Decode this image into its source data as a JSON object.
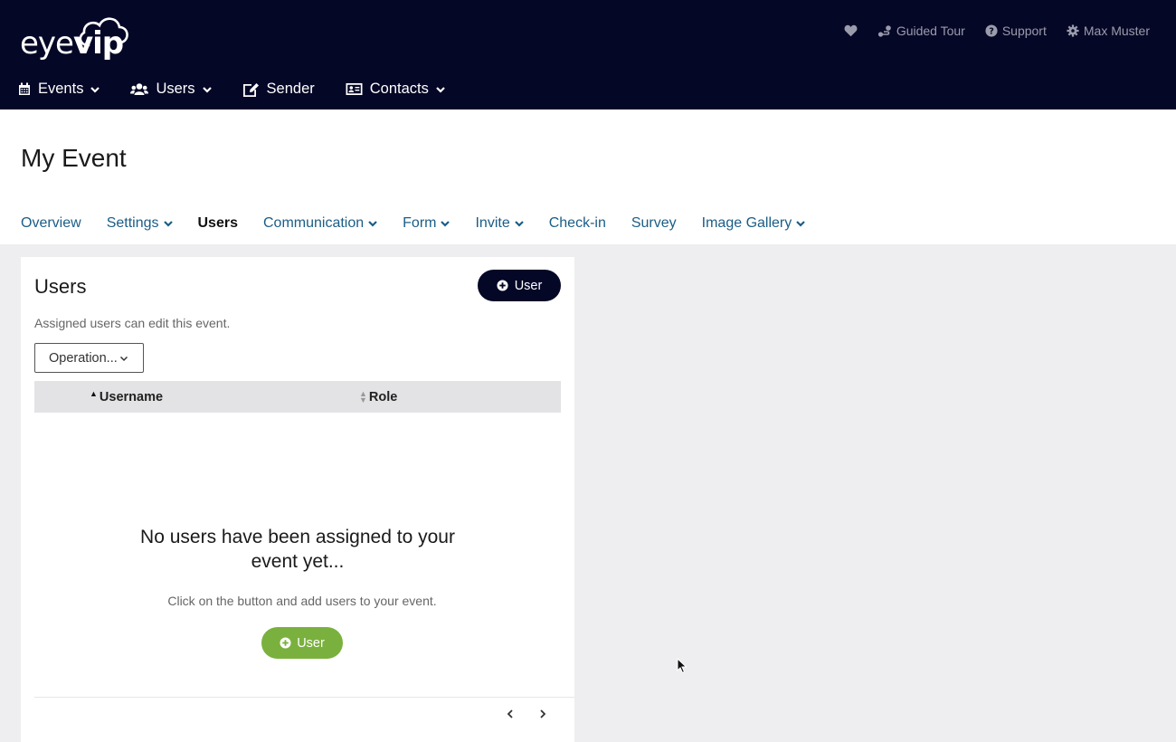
{
  "header": {
    "logo_text_regular": "eye",
    "logo_text_bold": "vip",
    "top_links": {
      "favorites_icon": "heart-icon",
      "guided_tour": "Guided Tour",
      "support": "Support",
      "user_name": "Max Muster"
    },
    "nav": {
      "events": "Events",
      "users": "Users",
      "sender": "Sender",
      "contacts": "Contacts"
    }
  },
  "event": {
    "title": "My Event",
    "tabs": [
      {
        "label": "Overview"
      },
      {
        "label": "Settings"
      },
      {
        "label": "Users"
      },
      {
        "label": "Communication"
      },
      {
        "label": "Form"
      },
      {
        "label": "Invite"
      },
      {
        "label": "Check-in"
      },
      {
        "label": "Survey"
      },
      {
        "label": "Image Gallery"
      }
    ]
  },
  "users_card": {
    "title": "Users",
    "add_button": "User",
    "description": "Assigned users can edit this event.",
    "operation_select": "Operation...",
    "columns": {
      "username": "Username",
      "role": "Role"
    },
    "empty_title": "No users have been assigned to your event yet...",
    "empty_desc": "Click on the button and add users to your event.",
    "empty_button": "User"
  },
  "colors": {
    "header_bg": "#050727",
    "accent_green": "#7ab13e",
    "tab_link": "#1b5d86"
  }
}
